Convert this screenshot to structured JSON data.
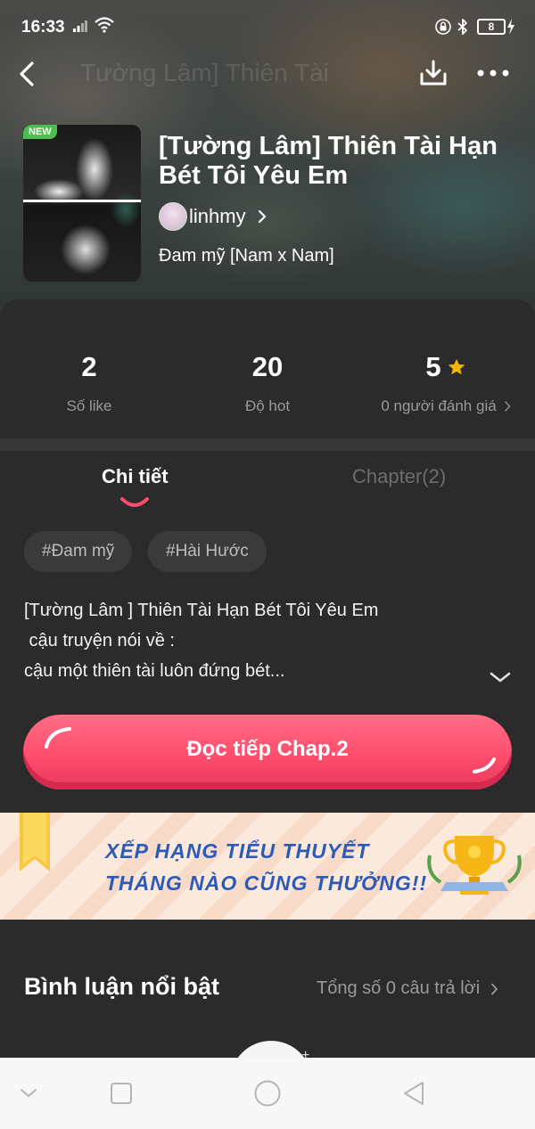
{
  "status_bar": {
    "time": "16:33",
    "battery": "8",
    "icons": [
      "signal-icon",
      "wifi-icon",
      "lock-icon",
      "bluetooth-icon",
      "battery-icon",
      "charging-icon"
    ]
  },
  "nav": {
    "faded_title": "Tường Lâm] Thiên Tài",
    "icons": [
      "back-icon",
      "download-icon",
      "more-icon"
    ]
  },
  "story": {
    "badge": "NEW",
    "title": "[Tường Lâm] Thiên Tài Hạn Bét Tôi Yêu Em",
    "author": "linhmy",
    "genre": "Đam mỹ [Nam x Nam]"
  },
  "stats": {
    "likes_value": "2",
    "likes_label": "Số like",
    "hot_value": "20",
    "hot_label": "Độ hot",
    "rating_value": "5",
    "rating_label": "0 người đánh giá"
  },
  "tabs": {
    "details": "Chi tiết",
    "chapters": "Chapter(2)"
  },
  "tags": [
    "#Đam mỹ",
    "#Hài Hước"
  ],
  "description": {
    "line1": "[Tường Lâm ] Thiên Tài Hạn Bét Tôi Yêu Em",
    "line2": " cậu truyện nói về :",
    "line3": "cậu một thiên tài luôn đứng bét..."
  },
  "read_button": "Đọc tiếp Chap.2",
  "banner": {
    "line1": "XẾP HẠNG TIỂU THUYẾT",
    "line2": "THÁNG NÀO CŨNG THƯỞNG!!"
  },
  "comments": {
    "title": "Bình luận nổi bật",
    "count": "Tổng số 0 câu trả lời",
    "avatar_plus": "+"
  },
  "colors": {
    "accent": "#ff4d6d",
    "star": "#f5b800",
    "background": "#2b2b2b",
    "banner_text": "#2d5ab8"
  }
}
